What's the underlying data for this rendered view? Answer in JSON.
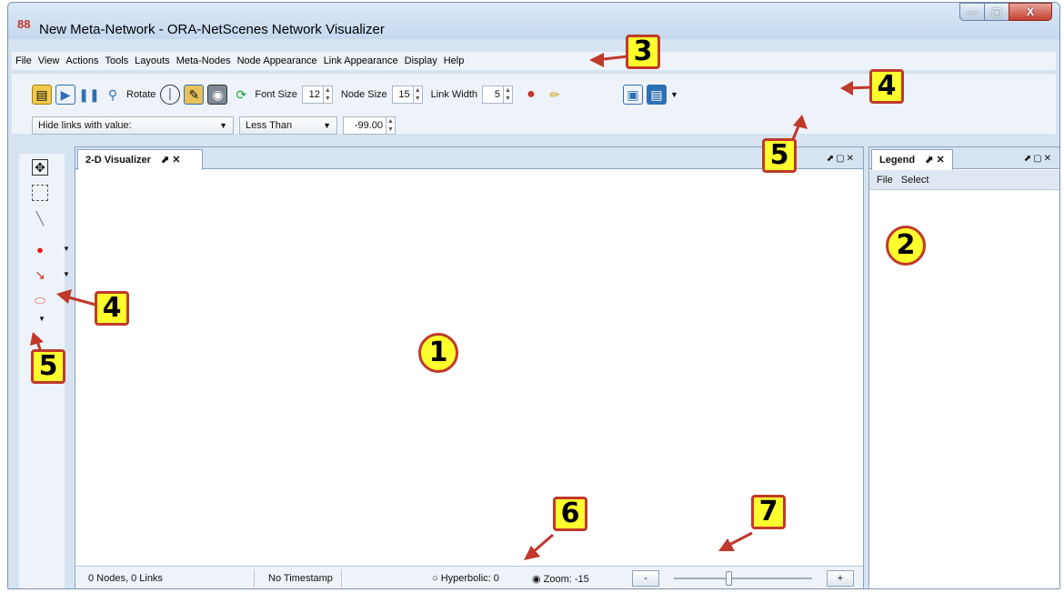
{
  "window": {
    "title": "New Meta-Network - ORA-NetScenes Network Visualizer",
    "controls": {
      "minimize": "—",
      "maximize": "▢",
      "close": "X"
    }
  },
  "menubar": [
    "File",
    "View",
    "Actions",
    "Tools",
    "Layouts",
    "Meta-Nodes",
    "Node Appearance",
    "Link Appearance",
    "Display",
    "Help"
  ],
  "toolbar": {
    "rotate_label": "Rotate",
    "font_size_label": "Font Size",
    "font_size_value": "12",
    "node_size_label": "Node Size",
    "node_size_value": "15",
    "link_width_label": "Link Width",
    "link_width_value": "5",
    "filter_select": "Hide links with value:",
    "comparison_select": "Less Than",
    "threshold_value": "-99.00"
  },
  "visualizer": {
    "tab_label": "2-D Visualizer",
    "tab_icons": "⬈ ✕",
    "panel_controls": "⬈▢✕"
  },
  "statusbar": {
    "counts": "0 Nodes, 0 Links",
    "timestamp": "No Timestamp",
    "hyperbolic": "Hyperbolic: 0",
    "zoom": "Zoom: -15",
    "zoom_out": "-",
    "zoom_in": "+"
  },
  "legend": {
    "tab_label": "Legend",
    "tab_icons": "⬈ ✕",
    "panel_controls": "⬈▢✕",
    "menu": [
      "File",
      "Select"
    ]
  },
  "callouts": {
    "c1": "1",
    "c2": "2",
    "c3": "3",
    "c4a": "4",
    "c4b": "4",
    "c5a": "5",
    "c5b": "5",
    "c6": "6",
    "c7": "7"
  },
  "colors": {
    "callout_fill": "#ffff2e",
    "callout_border": "#c0392b",
    "chrome": "#d6e4f2"
  }
}
